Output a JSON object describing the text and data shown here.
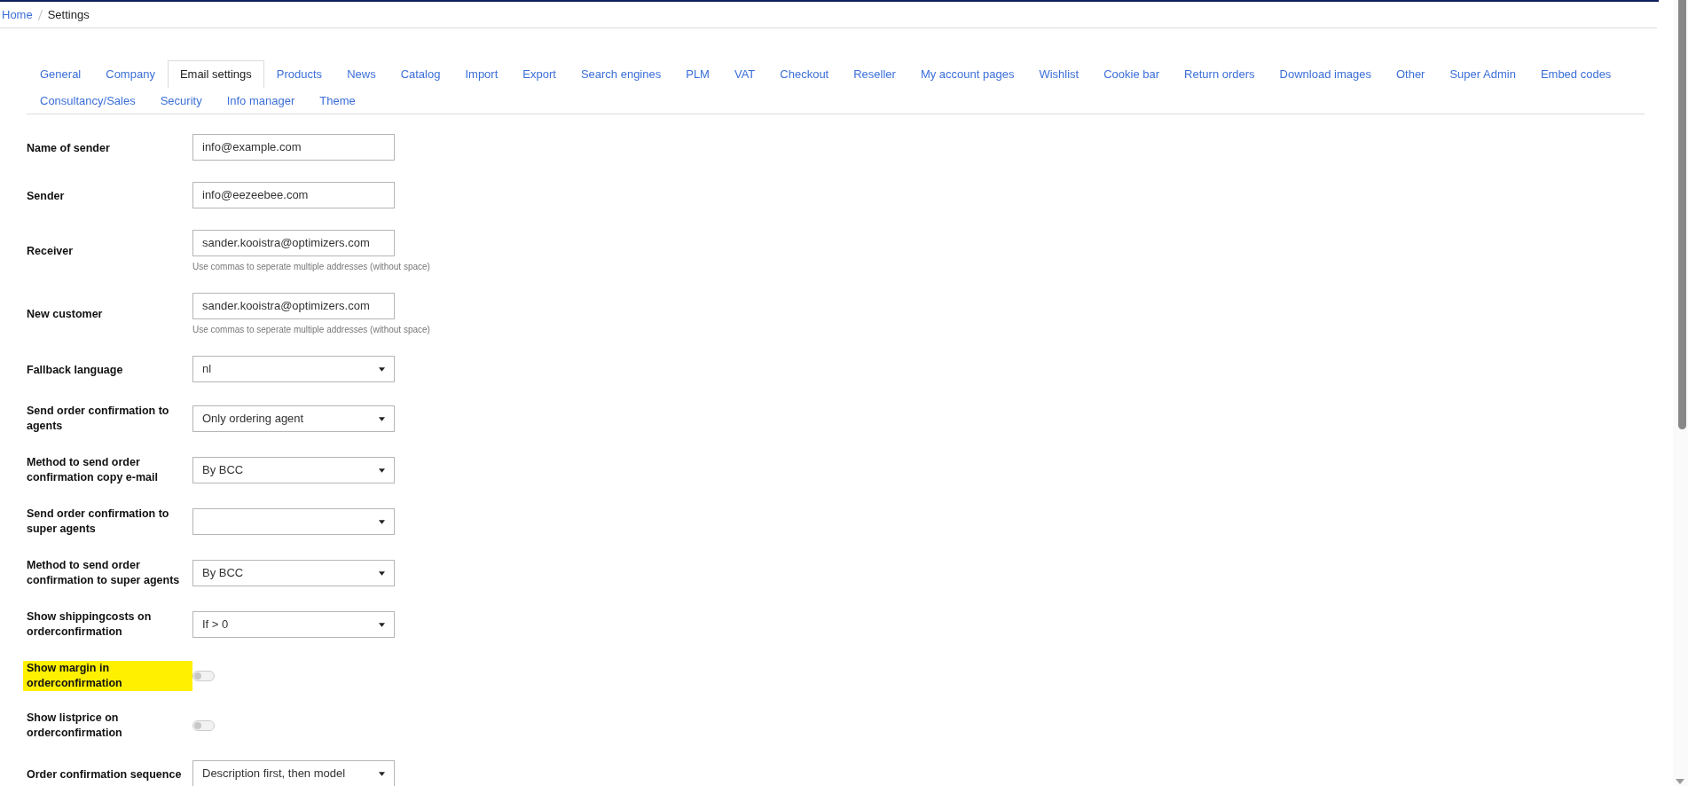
{
  "breadcrumb": [
    {
      "label": "Home",
      "link": true
    },
    {
      "label": "Settings",
      "link": false
    }
  ],
  "tabs": [
    {
      "label": "General",
      "selected": false
    },
    {
      "label": "Company",
      "selected": false
    },
    {
      "label": "Email settings",
      "selected": true
    },
    {
      "label": "Products",
      "selected": false
    },
    {
      "label": "News",
      "selected": false
    },
    {
      "label": "Catalog",
      "selected": false
    },
    {
      "label": "Import",
      "selected": false
    },
    {
      "label": "Export",
      "selected": false
    },
    {
      "label": "Search engines",
      "selected": false
    },
    {
      "label": "PLM",
      "selected": false
    },
    {
      "label": "VAT",
      "selected": false
    },
    {
      "label": "Checkout",
      "selected": false
    },
    {
      "label": "Reseller",
      "selected": false
    },
    {
      "label": "My account pages",
      "selected": false
    },
    {
      "label": "Wishlist",
      "selected": false
    },
    {
      "label": "Cookie bar",
      "selected": false
    },
    {
      "label": "Return orders",
      "selected": false
    },
    {
      "label": "Download images",
      "selected": false
    },
    {
      "label": "Other",
      "selected": false
    },
    {
      "label": "Super Admin",
      "selected": false
    },
    {
      "label": "Embed codes",
      "selected": false
    },
    {
      "label": "Consultancy/Sales",
      "selected": false
    },
    {
      "label": "Security",
      "selected": false
    },
    {
      "label": "Info manager",
      "selected": false
    },
    {
      "label": "Theme",
      "selected": false
    }
  ],
  "fields": [
    {
      "kind": "text",
      "label": "Name of sender",
      "value": "info@example.com",
      "highlighted": false
    },
    {
      "kind": "text",
      "label": "Sender",
      "value": "info@eezeebee.com",
      "highlighted": false
    },
    {
      "kind": "text",
      "label": "Receiver",
      "value": "sander.kooistra@optimizers.com",
      "hint": "Use commas to seperate multiple addresses (without space)",
      "highlighted": false
    },
    {
      "kind": "text",
      "label": "New customer",
      "value": "sander.kooistra@optimizers.com",
      "hint": "Use commas to seperate multiple addresses (without space)",
      "highlighted": false
    },
    {
      "kind": "select",
      "label": "Fallback language",
      "value": "nl",
      "highlighted": false
    },
    {
      "kind": "select",
      "label": "Send order confirmation to agents",
      "value": "Only ordering agent",
      "highlighted": false
    },
    {
      "kind": "select",
      "label": "Method to send order confirmation copy e-mail",
      "value": "By BCC",
      "highlighted": false
    },
    {
      "kind": "select",
      "label": "Send order confirmation to super agents",
      "highlighted": false
    },
    {
      "kind": "select",
      "label": "Method to send order confirmation to super agents",
      "value": "By BCC",
      "highlighted": false
    },
    {
      "kind": "select",
      "label": "Show shippingcosts on orderconfirmation",
      "value": "If > 0",
      "highlighted": false
    },
    {
      "kind": "toggle",
      "label": "Show margin in orderconfirmation",
      "on": false,
      "highlighted": true
    },
    {
      "kind": "toggle",
      "label": "Show listprice on orderconfirmation",
      "on": false,
      "highlighted": false
    },
    {
      "kind": "select",
      "label": "Order confirmation sequence",
      "value": "Description first, then model",
      "highlighted": false
    }
  ]
}
